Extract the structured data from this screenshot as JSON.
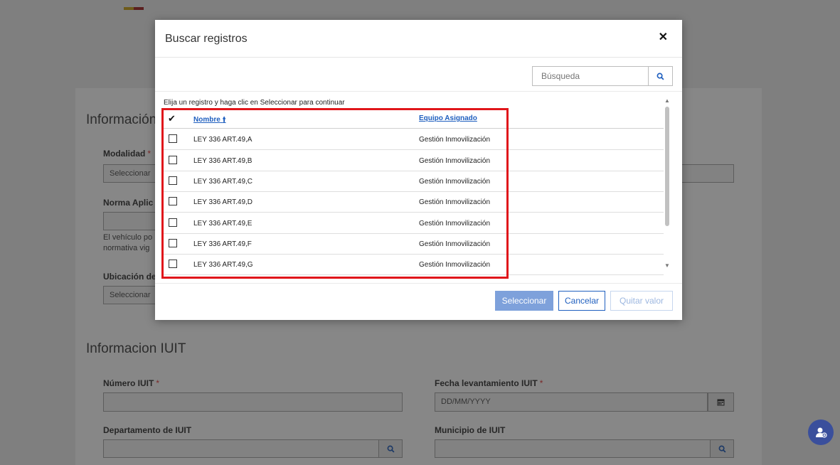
{
  "background": {
    "section1_title": "Información",
    "modalidad_label": "Modalidad",
    "modalidad_placeholder": "Seleccionar",
    "norma_label": "Norma Aplic",
    "help_line1": "El vehículo po",
    "help_line2": "normativa vig",
    "ubicacion_label": "Ubicación de",
    "ubicacion_placeholder": "Seleccionar",
    "section2_title": "Informacion IUIT",
    "numero_label": "Número IUIT",
    "fecha_label": "Fecha levantamiento IUIT",
    "fecha_placeholder": "DD/MM/YYYY",
    "departamento_label": "Departamento de IUIT",
    "municipio_label": "Municipio de IUIT",
    "required_mark": "*"
  },
  "modal": {
    "title": "Buscar registros",
    "close_glyph": "✕",
    "search_placeholder": "Búsqueda",
    "instructions": "Elija un registro y haga clic en Seleccionar para continuar",
    "header_check": "✔",
    "columns": {
      "name": "Nombre",
      "sort_glyph": "🠙",
      "team": "Equipo Asignado"
    },
    "rows": [
      {
        "name": "LEY 336 ART.49,A",
        "team": "Gestión Inmovilización"
      },
      {
        "name": "LEY 336 ART.49,B",
        "team": "Gestión Inmovilización"
      },
      {
        "name": "LEY 336 ART.49,C",
        "team": "Gestión Inmovilización"
      },
      {
        "name": "LEY 336 ART.49,D",
        "team": "Gestión Inmovilización"
      },
      {
        "name": "LEY 336 ART.49,E",
        "team": "Gestión Inmovilización"
      },
      {
        "name": "LEY 336 ART.49,F",
        "team": "Gestión Inmovilización"
      },
      {
        "name": "LEY 336 ART.49,G",
        "team": "Gestión Inmovilización"
      }
    ],
    "buttons": {
      "select": "Seleccionar",
      "cancel": "Cancelar",
      "clear": "Quitar valor"
    }
  },
  "colors": {
    "accent": "#1f5fbf",
    "highlight": "#e0161b",
    "primary_disabled": "#7ea1db"
  }
}
